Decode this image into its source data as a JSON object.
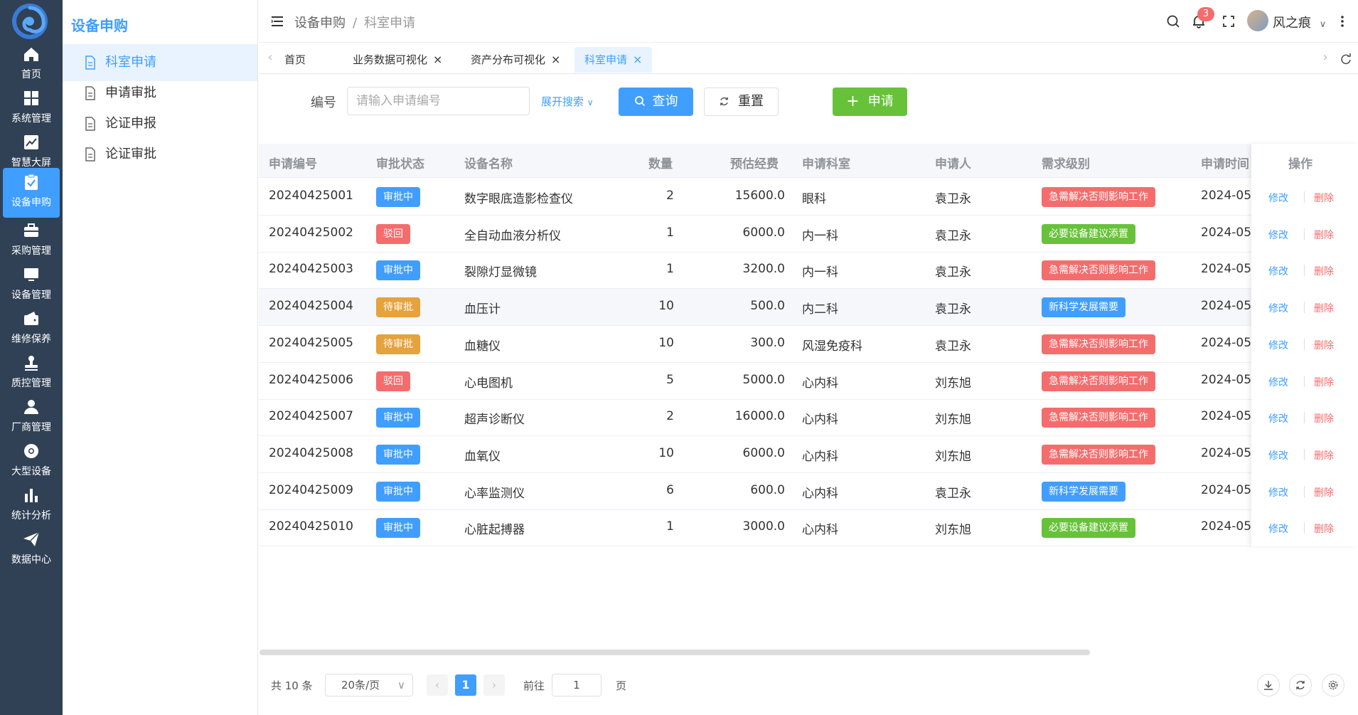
{
  "colors": {
    "primary": "#409eff",
    "success": "#67c23a",
    "warning": "#e6a23c",
    "danger": "#f56c6c",
    "sidebar": "#304156"
  },
  "rail": [
    {
      "label": "首页",
      "icon": "home-icon"
    },
    {
      "label": "系统管理",
      "icon": "grid-icon"
    },
    {
      "label": "智慧大屏",
      "icon": "chart-line-icon"
    },
    {
      "label": "设备申购",
      "icon": "clipboard-check-icon"
    },
    {
      "label": "采购管理",
      "icon": "briefcase-icon"
    },
    {
      "label": "设备管理",
      "icon": "monitor-icon"
    },
    {
      "label": "维修保养",
      "icon": "wallet-icon"
    },
    {
      "label": "质控管理",
      "icon": "stamp-icon"
    },
    {
      "label": "厂商管理",
      "icon": "user-icon"
    },
    {
      "label": "大型设备",
      "icon": "chrome-icon"
    },
    {
      "label": "统计分析",
      "icon": "bar-chart-icon"
    },
    {
      "label": "数据中心",
      "icon": "send-icon"
    }
  ],
  "submenu": {
    "title": "设备申购",
    "items": [
      {
        "label": "科室申请"
      },
      {
        "label": "申请审批"
      },
      {
        "label": "论证申报"
      },
      {
        "label": "论证审批"
      }
    ]
  },
  "header": {
    "breadcrumb": [
      "设备申购",
      "科室申请"
    ],
    "notification_count": "3",
    "username": "风之痕"
  },
  "tabs": [
    {
      "label": "首页"
    },
    {
      "label": "业务数据可视化"
    },
    {
      "label": "资产分布可视化"
    },
    {
      "label": "科室申请"
    }
  ],
  "search": {
    "label": "编号",
    "placeholder": "请输入申请编号",
    "expand": "展开搜索",
    "query": "查询",
    "reset": "重置",
    "apply": "申请"
  },
  "table": {
    "columns": [
      "申请编号",
      "审批状态",
      "设备名称",
      "数量",
      "预估经费",
      "申请科室",
      "申请人",
      "需求级别",
      "申请时间",
      "操作"
    ],
    "edit_label": "修改",
    "delete_label": "删除",
    "rows": [
      {
        "no": "20240425001",
        "status": "审批中",
        "status_type": "primary",
        "name": "数字眼底造影检查仪",
        "qty": "2",
        "budget": "15600.0",
        "dept": "眼科",
        "applicant": "袁卫永",
        "level": "急需解决否则影响工作",
        "level_type": "danger",
        "time": "2024-05-"
      },
      {
        "no": "20240425002",
        "status": "驳回",
        "status_type": "danger",
        "name": "全自动血液分析仪",
        "qty": "1",
        "budget": "6000.0",
        "dept": "内一科",
        "applicant": "袁卫永",
        "level": "必要设备建议添置",
        "level_type": "success",
        "time": "2024-05-"
      },
      {
        "no": "20240425003",
        "status": "审批中",
        "status_type": "primary",
        "name": "裂隙灯显微镜",
        "qty": "1",
        "budget": "3200.0",
        "dept": "内一科",
        "applicant": "袁卫永",
        "level": "急需解决否则影响工作",
        "level_type": "danger",
        "time": "2024-05-"
      },
      {
        "no": "20240425004",
        "status": "待审批",
        "status_type": "warning",
        "name": "血压计",
        "qty": "10",
        "budget": "500.0",
        "dept": "内二科",
        "applicant": "袁卫永",
        "level": "新科学发展需要",
        "level_type": "primary",
        "time": "2024-05-"
      },
      {
        "no": "20240425005",
        "status": "待审批",
        "status_type": "warning",
        "name": "血糖仪",
        "qty": "10",
        "budget": "300.0",
        "dept": "风湿免疫科",
        "applicant": "袁卫永",
        "level": "急需解决否则影响工作",
        "level_type": "danger",
        "time": "2024-05-"
      },
      {
        "no": "20240425006",
        "status": "驳回",
        "status_type": "danger",
        "name": "心电图机",
        "qty": "5",
        "budget": "5000.0",
        "dept": "心内科",
        "applicant": "刘东旭",
        "level": "急需解决否则影响工作",
        "level_type": "danger",
        "time": "2024-05-"
      },
      {
        "no": "20240425007",
        "status": "审批中",
        "status_type": "primary",
        "name": "超声诊断仪",
        "qty": "2",
        "budget": "16000.0",
        "dept": "心内科",
        "applicant": "刘东旭",
        "level": "急需解决否则影响工作",
        "level_type": "danger",
        "time": "2024-05-"
      },
      {
        "no": "20240425008",
        "status": "审批中",
        "status_type": "primary",
        "name": "血氧仪",
        "qty": "10",
        "budget": "6000.0",
        "dept": "心内科",
        "applicant": "刘东旭",
        "level": "急需解决否则影响工作",
        "level_type": "danger",
        "time": "2024-05-"
      },
      {
        "no": "20240425009",
        "status": "审批中",
        "status_type": "primary",
        "name": "心率监测仪",
        "qty": "6",
        "budget": "600.0",
        "dept": "心内科",
        "applicant": "袁卫永",
        "level": "新科学发展需要",
        "level_type": "primary",
        "time": "2024-05-"
      },
      {
        "no": "20240425010",
        "status": "审批中",
        "status_type": "primary",
        "name": "心脏起搏器",
        "qty": "1",
        "budget": "3000.0",
        "dept": "心内科",
        "applicant": "刘东旭",
        "level": "必要设备建议添置",
        "level_type": "success",
        "time": "2024-05-"
      }
    ]
  },
  "pagination": {
    "total": "共 10 条",
    "page_size": "20条/页",
    "current_page": "1",
    "goto_label": "前往",
    "goto_value": "1",
    "page_suffix": "页"
  }
}
